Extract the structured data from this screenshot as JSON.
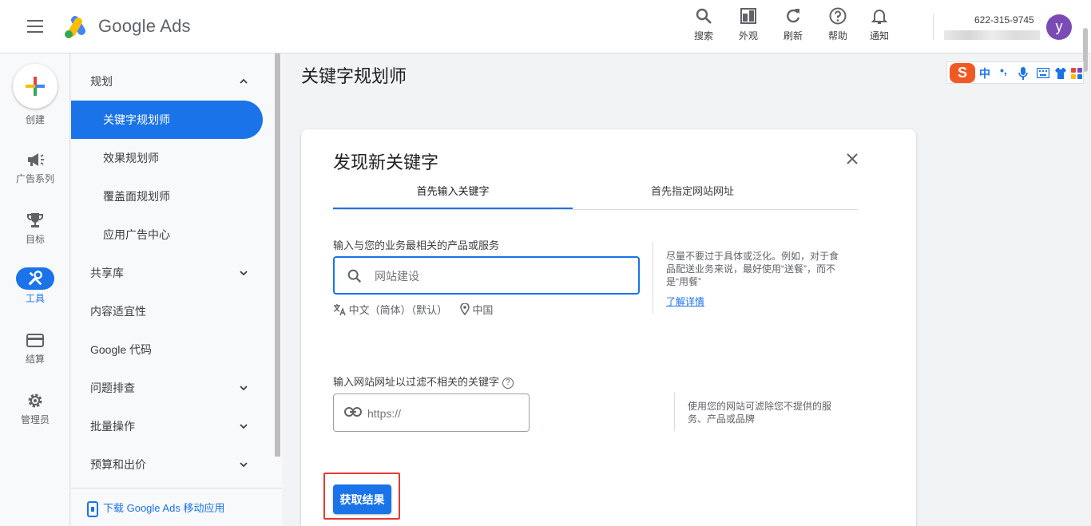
{
  "header": {
    "brand": "Google Ads",
    "tools": [
      {
        "label": "搜索",
        "icon": "search-icon"
      },
      {
        "label": "外观",
        "icon": "appearance-icon"
      },
      {
        "label": "刷新",
        "icon": "refresh-icon"
      },
      {
        "label": "帮助",
        "icon": "help-icon"
      },
      {
        "label": "通知",
        "icon": "bell-icon"
      }
    ],
    "account_id": "622-315-9745",
    "avatar_letter": "y"
  },
  "rail": {
    "create_label": "创建",
    "items": [
      {
        "label": "广告系列",
        "icon": "megaphone-icon"
      },
      {
        "label": "目标",
        "icon": "trophy-icon"
      },
      {
        "label": "工具",
        "icon": "tools-icon",
        "active": true
      },
      {
        "label": "结算",
        "icon": "credit-card-icon"
      },
      {
        "label": "管理员",
        "icon": "gear-icon"
      }
    ]
  },
  "nav": {
    "items": [
      {
        "label": "规划",
        "chevron": "up"
      },
      {
        "label": "关键字规划师",
        "sub": true,
        "selected": true
      },
      {
        "label": "效果规划师",
        "sub": true
      },
      {
        "label": "覆盖面规划师",
        "sub": true
      },
      {
        "label": "应用广告中心",
        "sub": true
      },
      {
        "label": "共享库",
        "chevron": "down"
      },
      {
        "label": "内容适宜性"
      },
      {
        "label": "Google 代码"
      },
      {
        "label": "问题排查",
        "chevron": "down"
      },
      {
        "label": "批量操作",
        "chevron": "down"
      },
      {
        "label": "预算和出价",
        "chevron": "down"
      }
    ],
    "download_label": "下载 Google Ads 移动应用"
  },
  "page": {
    "title": "关键字规划师"
  },
  "ime": {
    "logo": "S",
    "mode": "中",
    "punct": "•,"
  },
  "card": {
    "title": "发现新关键字",
    "tabs": [
      "首先输入关键字",
      "首先指定网站网址"
    ],
    "keyword_label": "输入与您的业务最相关的产品或服务",
    "keyword_placeholder": "网站建设",
    "language": "中文（简体）（默认）",
    "location": "中国",
    "keyword_tip": "尽量不要过于具体或泛化。例如，对于食品配送业务来说，最好使用“送餐”，而不是“用餐”",
    "learn_more": "了解详情",
    "url_label": "输入网站网址以过滤不相关的关键字",
    "help_mark": "?",
    "url_placeholder": "https://",
    "url_tip": "使用您的网站可滤除您不提供的服务、产品或品牌",
    "submit_label": "获取结果"
  },
  "colors": {
    "primary": "#1a73e8",
    "highlight": "#e53935",
    "avatar": "#7b4bb5"
  }
}
